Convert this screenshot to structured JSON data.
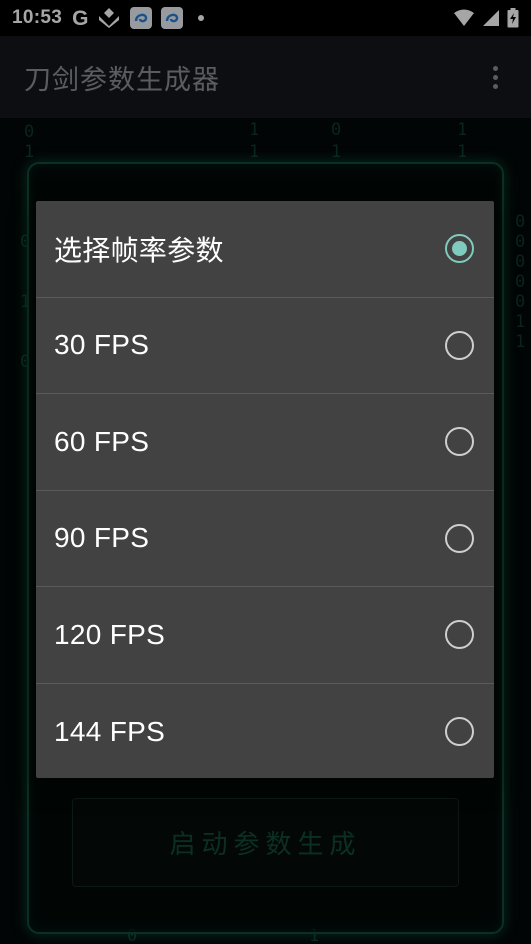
{
  "status_bar": {
    "time": "10:53",
    "left_icons": [
      "g-icon",
      "arrow-cluster-icon",
      "app-icon",
      "app-icon",
      "dot-icon"
    ],
    "right_icons": [
      "wifi-icon",
      "cellular-signal-icon",
      "battery-charging-icon"
    ]
  },
  "app_bar": {
    "title": "刀剑参数生成器",
    "overflow_icon": "overflow-menu-icon"
  },
  "main": {
    "generate_button_label": "启动参数生成"
  },
  "dialog": {
    "options": [
      {
        "label": "选择帧率参数",
        "checked": true
      },
      {
        "label": "30 FPS",
        "checked": false
      },
      {
        "label": "60 FPS",
        "checked": false
      },
      {
        "label": "90 FPS",
        "checked": false
      },
      {
        "label": "120 FPS",
        "checked": false
      },
      {
        "label": "144 FPS",
        "checked": false
      }
    ]
  },
  "colors": {
    "accent": "#7fcbbd",
    "dialog_bg": "#424242",
    "panel_glow": "#0f4a35"
  }
}
